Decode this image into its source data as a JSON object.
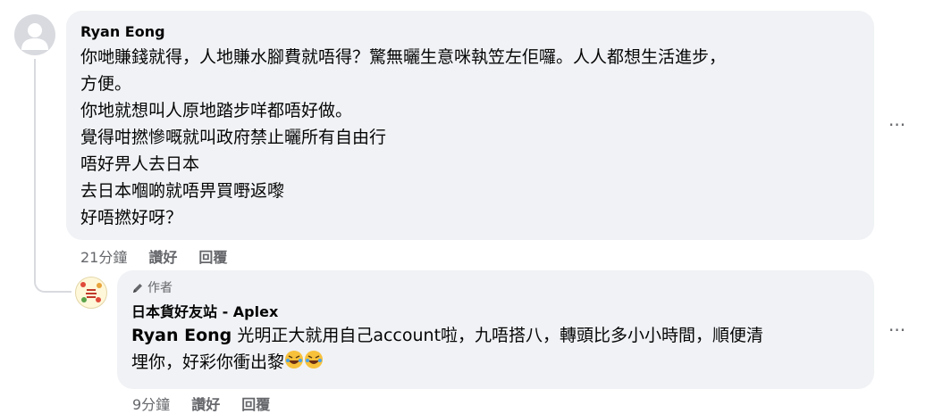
{
  "comment": {
    "author": "Ryan Eong",
    "lines": [
      "你哋賺錢就得，人地賺水腳費就唔得？驚無曬生意咪執笠左佢囉。人人都想生活進步，",
      "方便。",
      "你地就想叫人原地踏步咩都唔好做。",
      "覺得咁撚慘嘅就叫政府禁止曬所有自由行",
      "唔好畀人去日本",
      "去日本嗰啲就唔畀買嘢返嚟",
      "好唔撚好呀？"
    ],
    "timestamp": "21分鐘",
    "like_label": "讚好",
    "reply_label": "回覆",
    "more_label": "···"
  },
  "reply": {
    "author_badge": "作者",
    "author": "日本貨好友站 - Aplex",
    "mention": "Ryan Eong",
    "line1": " 光明正大就用自己account啦，九唔搭八，轉頭比多小小時間，順便清",
    "line2": "埋你，好彩你衝出黎",
    "timestamp": "9分鐘",
    "like_label": "讚好",
    "reply_label": "回覆",
    "more_label": "···"
  }
}
